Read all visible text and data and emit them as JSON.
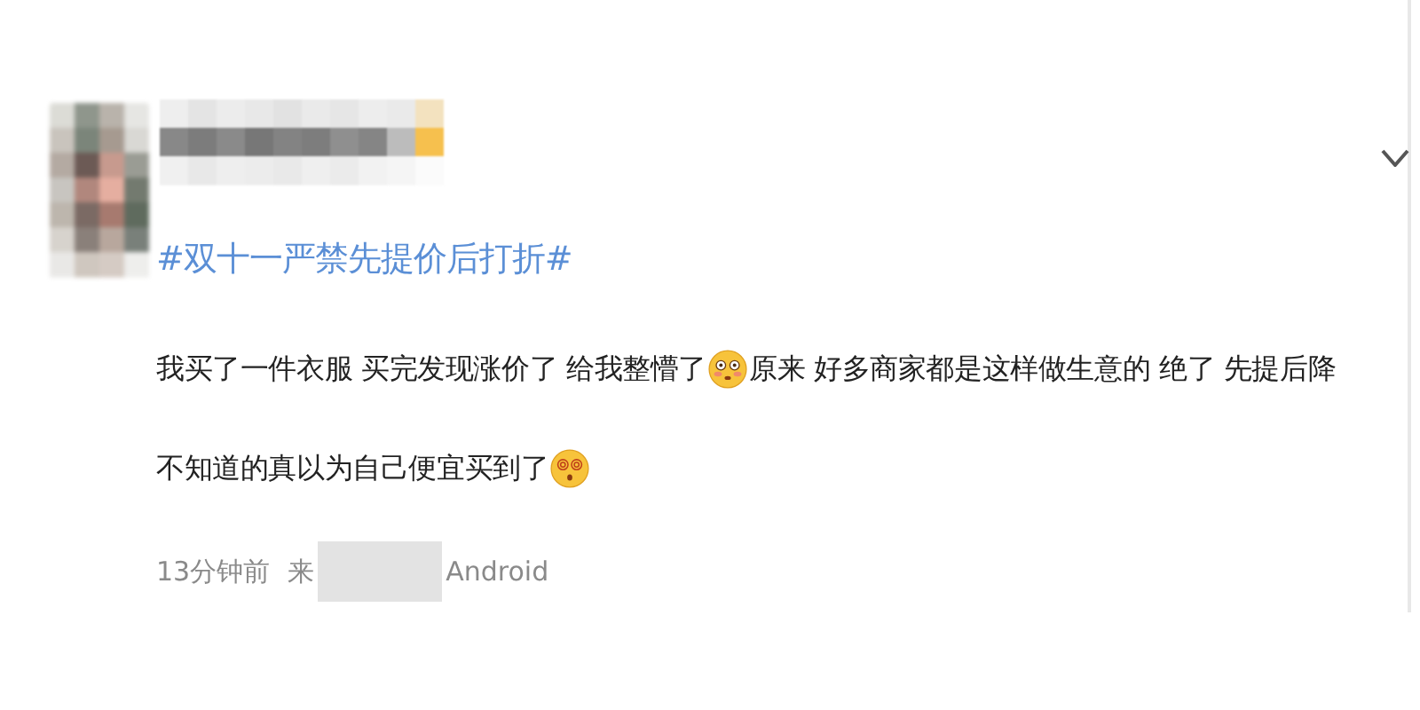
{
  "post": {
    "hashtag": "#双十一严禁先提价后打折#",
    "lines": [
      [
        {
          "kind": "text",
          "text": "我买了一件衣服 买完发现涨价了 给我整懵了"
        },
        {
          "kind": "blush"
        },
        {
          "kind": "text",
          "text": "原来 好多商家都是这样做生意的 绝了 先提后降"
        }
      ],
      [
        {
          "kind": "text",
          "text": "不知道的真以为自己便宜买到了"
        },
        {
          "kind": "dizzy"
        }
      ]
    ],
    "time": "13分钟前",
    "source_prefix": "来",
    "source_suffix": "Android"
  }
}
